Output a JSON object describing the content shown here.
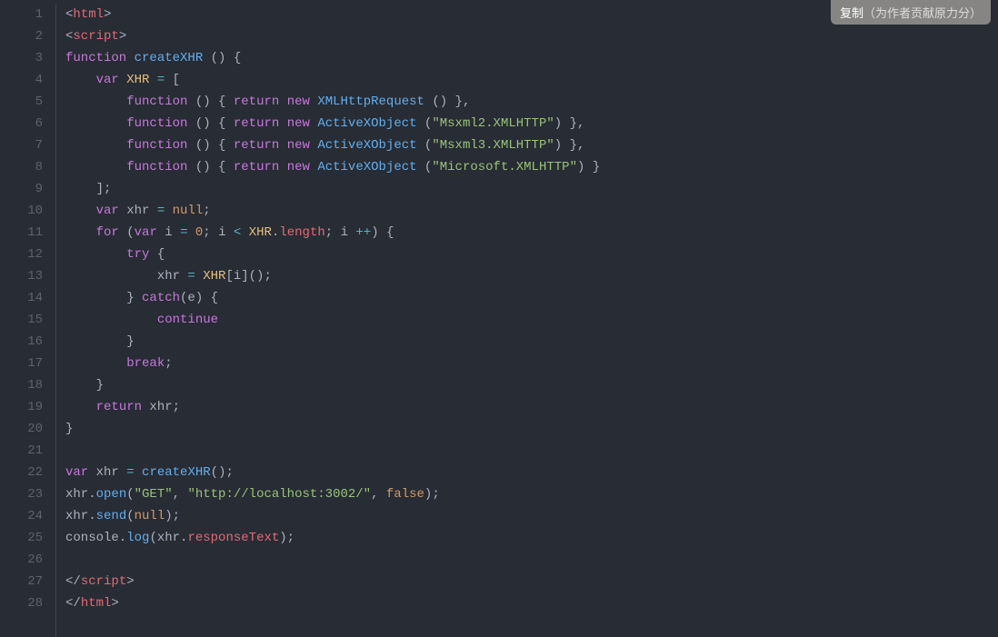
{
  "copy_button": {
    "main": "复制",
    "sub": "（为作者贡献原力分）"
  },
  "lines": {
    "count": 28,
    "numbers": [
      "1",
      "2",
      "3",
      "4",
      "5",
      "6",
      "7",
      "8",
      "9",
      "10",
      "11",
      "12",
      "13",
      "14",
      "15",
      "16",
      "17",
      "18",
      "19",
      "20",
      "21",
      "22",
      "23",
      "24",
      "25",
      "26",
      "27",
      "28"
    ]
  },
  "code": [
    [
      {
        "cls": "tok-punct",
        "t": "<"
      },
      {
        "cls": "tok-tag",
        "t": "html"
      },
      {
        "cls": "tok-punct",
        "t": ">"
      }
    ],
    [
      {
        "cls": "tok-punct",
        "t": "<"
      },
      {
        "cls": "tok-tag",
        "t": "script"
      },
      {
        "cls": "tok-punct",
        "t": ">"
      }
    ],
    [
      {
        "cls": "tok-keyword",
        "t": "function"
      },
      {
        "cls": "tok-punct",
        "t": " "
      },
      {
        "cls": "tok-func",
        "t": "createXHR"
      },
      {
        "cls": "tok-punct",
        "t": " () {"
      }
    ],
    [
      {
        "cls": "tok-punct",
        "t": "    "
      },
      {
        "cls": "tok-keyword",
        "t": "var"
      },
      {
        "cls": "tok-punct",
        "t": " "
      },
      {
        "cls": "tok-var",
        "t": "XHR"
      },
      {
        "cls": "tok-punct",
        "t": " "
      },
      {
        "cls": "tok-op",
        "t": "="
      },
      {
        "cls": "tok-punct",
        "t": " ["
      }
    ],
    [
      {
        "cls": "tok-punct",
        "t": "        "
      },
      {
        "cls": "tok-keyword",
        "t": "function"
      },
      {
        "cls": "tok-punct",
        "t": " () { "
      },
      {
        "cls": "tok-keyword",
        "t": "return"
      },
      {
        "cls": "tok-punct",
        "t": " "
      },
      {
        "cls": "tok-keyword",
        "t": "new"
      },
      {
        "cls": "tok-punct",
        "t": " "
      },
      {
        "cls": "tok-func",
        "t": "XMLHttpRequest"
      },
      {
        "cls": "tok-punct",
        "t": " () },"
      }
    ],
    [
      {
        "cls": "tok-punct",
        "t": "        "
      },
      {
        "cls": "tok-keyword",
        "t": "function"
      },
      {
        "cls": "tok-punct",
        "t": " () { "
      },
      {
        "cls": "tok-keyword",
        "t": "return"
      },
      {
        "cls": "tok-punct",
        "t": " "
      },
      {
        "cls": "tok-keyword",
        "t": "new"
      },
      {
        "cls": "tok-punct",
        "t": " "
      },
      {
        "cls": "tok-func",
        "t": "ActiveXObject"
      },
      {
        "cls": "tok-punct",
        "t": " ("
      },
      {
        "cls": "tok-string",
        "t": "\"Msxml2.XMLHTTP\""
      },
      {
        "cls": "tok-punct",
        "t": ") },"
      }
    ],
    [
      {
        "cls": "tok-punct",
        "t": "        "
      },
      {
        "cls": "tok-keyword",
        "t": "function"
      },
      {
        "cls": "tok-punct",
        "t": " () { "
      },
      {
        "cls": "tok-keyword",
        "t": "return"
      },
      {
        "cls": "tok-punct",
        "t": " "
      },
      {
        "cls": "tok-keyword",
        "t": "new"
      },
      {
        "cls": "tok-punct",
        "t": " "
      },
      {
        "cls": "tok-func",
        "t": "ActiveXObject"
      },
      {
        "cls": "tok-punct",
        "t": " ("
      },
      {
        "cls": "tok-string",
        "t": "\"Msxml3.XMLHTTP\""
      },
      {
        "cls": "tok-punct",
        "t": ") },"
      }
    ],
    [
      {
        "cls": "tok-punct",
        "t": "        "
      },
      {
        "cls": "tok-keyword",
        "t": "function"
      },
      {
        "cls": "tok-punct",
        "t": " () { "
      },
      {
        "cls": "tok-keyword",
        "t": "return"
      },
      {
        "cls": "tok-punct",
        "t": " "
      },
      {
        "cls": "tok-keyword",
        "t": "new"
      },
      {
        "cls": "tok-punct",
        "t": " "
      },
      {
        "cls": "tok-func",
        "t": "ActiveXObject"
      },
      {
        "cls": "tok-punct",
        "t": " ("
      },
      {
        "cls": "tok-string",
        "t": "\"Microsoft.XMLHTTP\""
      },
      {
        "cls": "tok-punct",
        "t": ") }"
      }
    ],
    [
      {
        "cls": "tok-punct",
        "t": "    ];"
      }
    ],
    [
      {
        "cls": "tok-punct",
        "t": "    "
      },
      {
        "cls": "tok-keyword",
        "t": "var"
      },
      {
        "cls": "tok-punct",
        "t": " xhr "
      },
      {
        "cls": "tok-op",
        "t": "="
      },
      {
        "cls": "tok-punct",
        "t": " "
      },
      {
        "cls": "tok-bool",
        "t": "null"
      },
      {
        "cls": "tok-punct",
        "t": ";"
      }
    ],
    [
      {
        "cls": "tok-punct",
        "t": "    "
      },
      {
        "cls": "tok-keyword",
        "t": "for"
      },
      {
        "cls": "tok-punct",
        "t": " ("
      },
      {
        "cls": "tok-keyword",
        "t": "var"
      },
      {
        "cls": "tok-punct",
        "t": " i "
      },
      {
        "cls": "tok-op",
        "t": "="
      },
      {
        "cls": "tok-punct",
        "t": " "
      },
      {
        "cls": "tok-num",
        "t": "0"
      },
      {
        "cls": "tok-punct",
        "t": "; i "
      },
      {
        "cls": "tok-op",
        "t": "<"
      },
      {
        "cls": "tok-punct",
        "t": " "
      },
      {
        "cls": "tok-var",
        "t": "XHR"
      },
      {
        "cls": "tok-punct",
        "t": "."
      },
      {
        "cls": "tok-prop",
        "t": "length"
      },
      {
        "cls": "tok-punct",
        "t": "; i "
      },
      {
        "cls": "tok-op",
        "t": "++"
      },
      {
        "cls": "tok-punct",
        "t": ") {"
      }
    ],
    [
      {
        "cls": "tok-punct",
        "t": "        "
      },
      {
        "cls": "tok-keyword",
        "t": "try"
      },
      {
        "cls": "tok-punct",
        "t": " {"
      }
    ],
    [
      {
        "cls": "tok-punct",
        "t": "            xhr "
      },
      {
        "cls": "tok-op",
        "t": "="
      },
      {
        "cls": "tok-punct",
        "t": " "
      },
      {
        "cls": "tok-var",
        "t": "XHR"
      },
      {
        "cls": "tok-punct",
        "t": "[i]();"
      }
    ],
    [
      {
        "cls": "tok-punct",
        "t": "        } "
      },
      {
        "cls": "tok-keyword",
        "t": "catch"
      },
      {
        "cls": "tok-punct",
        "t": "(e) {"
      }
    ],
    [
      {
        "cls": "tok-punct",
        "t": "            "
      },
      {
        "cls": "tok-keyword",
        "t": "continue"
      }
    ],
    [
      {
        "cls": "tok-punct",
        "t": "        }"
      }
    ],
    [
      {
        "cls": "tok-punct",
        "t": "        "
      },
      {
        "cls": "tok-keyword",
        "t": "break"
      },
      {
        "cls": "tok-punct",
        "t": ";"
      }
    ],
    [
      {
        "cls": "tok-punct",
        "t": "    }"
      }
    ],
    [
      {
        "cls": "tok-punct",
        "t": "    "
      },
      {
        "cls": "tok-keyword",
        "t": "return"
      },
      {
        "cls": "tok-punct",
        "t": " xhr;"
      }
    ],
    [
      {
        "cls": "tok-punct",
        "t": "}"
      }
    ],
    [],
    [
      {
        "cls": "tok-keyword",
        "t": "var"
      },
      {
        "cls": "tok-punct",
        "t": " xhr "
      },
      {
        "cls": "tok-op",
        "t": "="
      },
      {
        "cls": "tok-punct",
        "t": " "
      },
      {
        "cls": "tok-func",
        "t": "createXHR"
      },
      {
        "cls": "tok-punct",
        "t": "();"
      }
    ],
    [
      {
        "cls": "tok-punct",
        "t": "xhr."
      },
      {
        "cls": "tok-func",
        "t": "open"
      },
      {
        "cls": "tok-punct",
        "t": "("
      },
      {
        "cls": "tok-string",
        "t": "\"GET\""
      },
      {
        "cls": "tok-punct",
        "t": ", "
      },
      {
        "cls": "tok-string",
        "t": "\"http://localhost:3002/\""
      },
      {
        "cls": "tok-punct",
        "t": ", "
      },
      {
        "cls": "tok-bool",
        "t": "false"
      },
      {
        "cls": "tok-punct",
        "t": ");"
      }
    ],
    [
      {
        "cls": "tok-punct",
        "t": "xhr."
      },
      {
        "cls": "tok-func",
        "t": "send"
      },
      {
        "cls": "tok-punct",
        "t": "("
      },
      {
        "cls": "tok-bool",
        "t": "null"
      },
      {
        "cls": "tok-punct",
        "t": ");"
      }
    ],
    [
      {
        "cls": "tok-punct",
        "t": "console."
      },
      {
        "cls": "tok-func",
        "t": "log"
      },
      {
        "cls": "tok-punct",
        "t": "(xhr."
      },
      {
        "cls": "tok-prop",
        "t": "responseText"
      },
      {
        "cls": "tok-punct",
        "t": ");"
      }
    ],
    [],
    [
      {
        "cls": "tok-punct",
        "t": "</"
      },
      {
        "cls": "tok-tag",
        "t": "script"
      },
      {
        "cls": "tok-punct",
        "t": ">"
      }
    ],
    [
      {
        "cls": "tok-punct",
        "t": "</"
      },
      {
        "cls": "tok-tag",
        "t": "html"
      },
      {
        "cls": "tok-punct",
        "t": ">"
      }
    ]
  ]
}
